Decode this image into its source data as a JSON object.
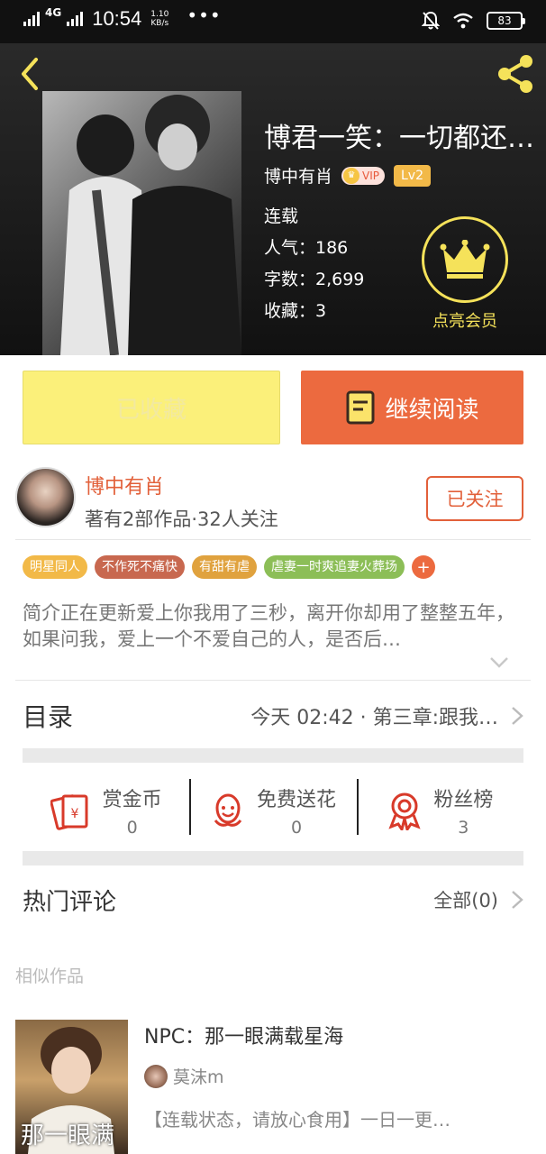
{
  "status_bar": {
    "network": "4G",
    "time": "10:54",
    "speed_value": "1.10",
    "speed_unit": "KB/s",
    "more": "•••",
    "battery": "83"
  },
  "book": {
    "title": "博君一笑：一切都还…",
    "author": "博中有肖",
    "vip_label": "VIP",
    "level": "Lv2",
    "status": "连载",
    "popularity": "人气：186",
    "word_count": "字数：2,699",
    "favorites": "收藏：3",
    "member_label": "点亮会员"
  },
  "actions": {
    "favorited_label": "已收藏",
    "continue_label": "继续阅读"
  },
  "author_card": {
    "name": "博中有肖",
    "info": "著有2部作品·32人关注",
    "follow_label": "已关注"
  },
  "tags": [
    {
      "label": "明星同人",
      "color": "#f2b948"
    },
    {
      "label": "不作死不痛快",
      "color": "#c8684f"
    },
    {
      "label": "有甜有虐",
      "color": "#e0a23e"
    },
    {
      "label": "虐妻一时爽追妻火葬场",
      "color": "#8cbe57"
    }
  ],
  "tag_more": "+",
  "intro": "简介正在更新爱上你我用了三秒，离开你却用了整整五年，如果问我，爱上一个不爱自己的人，是否后…",
  "toc": {
    "label": "目录",
    "latest": "今天 02:42 · 第三章:跟我…"
  },
  "stats": [
    {
      "label": "赏金币",
      "value": "0",
      "icon": "red-envelope-icon"
    },
    {
      "label": "免费送花",
      "value": "0",
      "icon": "flower-icon"
    },
    {
      "label": "粉丝榜",
      "value": "3",
      "icon": "medal-icon"
    }
  ],
  "comments": {
    "label": "热门评论",
    "all": "全部(0)"
  },
  "similar": {
    "section_label": "相似作品",
    "title": "NPC：那一眼满载星海",
    "author": "莫沫m",
    "desc": "【连载状态，请放心食用】一日一更…",
    "cover_text": "那一眼满"
  },
  "colors": {
    "accent": "#ec6a3f",
    "fav_button": "#fbf07a",
    "member_gold": "#f5e25a"
  }
}
